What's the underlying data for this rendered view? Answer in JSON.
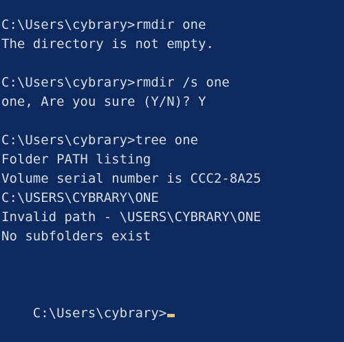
{
  "colors": {
    "background": "#0c2a5e",
    "text": "#d9dde6",
    "cursor": "#e7c27a"
  },
  "terminal": {
    "lines": [
      "C:\\Users\\cybrary>rmdir one",
      "The directory is not empty.",
      "",
      "C:\\Users\\cybrary>rmdir /s one",
      "one, Are you sure (Y/N)? Y",
      "",
      "C:\\Users\\cybrary>tree one",
      "Folder PATH listing",
      "Volume serial number is CCC2-8A25",
      "C:\\USERS\\CYBRARY\\ONE",
      "Invalid path - \\USERS\\CYBRARY\\ONE",
      "No subfolders exist"
    ],
    "current_prompt": "C:\\Users\\cybrary>"
  }
}
